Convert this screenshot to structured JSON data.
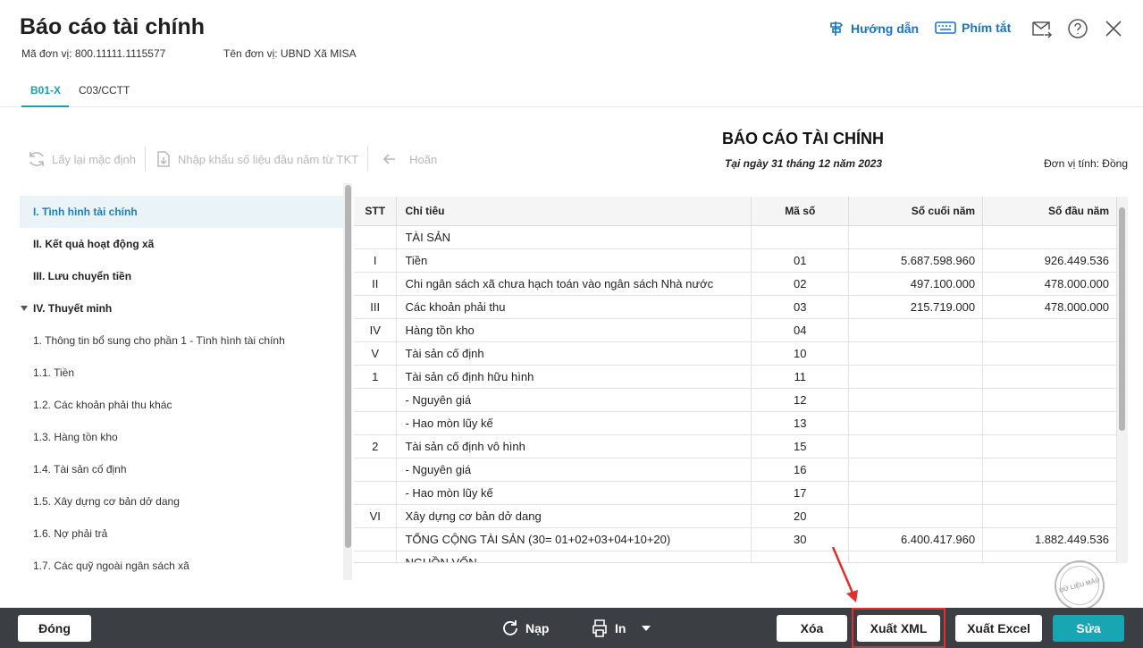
{
  "header": {
    "title": "Báo cáo tài chính",
    "unit_code_label": "Mã đơn vị: 800.11111.1115577",
    "unit_name_label": "Tên đơn vị: UBND Xã MISA",
    "guide_label": "Hướng dẫn",
    "shortcut_label": "Phím tắt"
  },
  "tabs": [
    "B01-X",
    "C03/CCTT"
  ],
  "toolbar": {
    "reset_label": "Lấy lại mặc định",
    "import_label": "Nhập khẩu số liệu đầu năm từ TKT",
    "undo_label": "Hoãn"
  },
  "report": {
    "title": "BÁO CÁO TÀI CHÍNH",
    "date": "Tại ngày 31 tháng 12 năm 2023",
    "unit": "Đơn vị tính: Đồng"
  },
  "sidebar": {
    "items": [
      "I. Tình hình tài chính",
      "II. Kết quả hoạt động xã",
      "III. Lưu chuyển tiền",
      "IV. Thuyết minh",
      "1. Thông tin bổ sung cho phần 1 - Tình hình tài chính",
      "1.1. Tiền",
      "1.2. Các khoản phải thu khác",
      "1.3. Hàng tồn kho",
      "1.4. Tài sản cố định",
      "1.5. Xây dựng cơ bản dở dang",
      "1.6. Nợ phải trả",
      "1.7. Các quỹ ngoài ngân sách xã"
    ]
  },
  "table": {
    "headers": [
      "STT",
      "Chỉ tiêu",
      "Mã số",
      "Số cuối năm",
      "Số đầu năm"
    ],
    "rows": [
      [
        "",
        "TÀI SẢN",
        "",
        "",
        ""
      ],
      [
        "I",
        "Tiền",
        "01",
        "5.687.598.960",
        "926.449.536"
      ],
      [
        "II",
        "Chi ngân sách xã chưa hạch toán vào ngân sách Nhà nước",
        "02",
        "497.100.000",
        "478.000.000"
      ],
      [
        "III",
        "Các khoản phải thu",
        "03",
        "215.719.000",
        "478.000.000"
      ],
      [
        "IV",
        "Hàng tồn kho",
        "04",
        "",
        ""
      ],
      [
        "V",
        "Tài sản cố định",
        "10",
        "",
        ""
      ],
      [
        "1",
        "Tài sản cố định hữu hình",
        "11",
        "",
        ""
      ],
      [
        "",
        "- Nguyên giá",
        "12",
        "",
        ""
      ],
      [
        "",
        "- Hao mòn lũy kế",
        "13",
        "",
        ""
      ],
      [
        "2",
        "Tài sản cố định vô hình",
        "15",
        "",
        ""
      ],
      [
        "",
        "- Nguyên giá",
        "16",
        "",
        ""
      ],
      [
        "",
        "- Hao mòn lũy kế",
        "17",
        "",
        ""
      ],
      [
        "VI",
        "Xây dựng cơ bản dở dang",
        "20",
        "",
        ""
      ],
      [
        "",
        "TỔNG CỘNG TÀI SẢN (30= 01+02+03+04+10+20)",
        "30",
        "6.400.417.960",
        "1.882.449.536"
      ],
      [
        "",
        "NGUỒN VỐN",
        "",
        "",
        ""
      ]
    ]
  },
  "stamp_text": "DỮ LIỆU MẪU",
  "footer": {
    "close_label": "Đóng",
    "load_label": "Nạp",
    "print_label": "In",
    "delete_label": "Xóa",
    "export_xml_label": "Xuất XML",
    "export_excel_label": "Xuất Excel",
    "edit_label": "Sửa"
  },
  "colors": {
    "accent": "#18a6b2",
    "link": "#1a73c8",
    "footer_bg": "#3b3f43",
    "highlight": "#e0302d"
  }
}
